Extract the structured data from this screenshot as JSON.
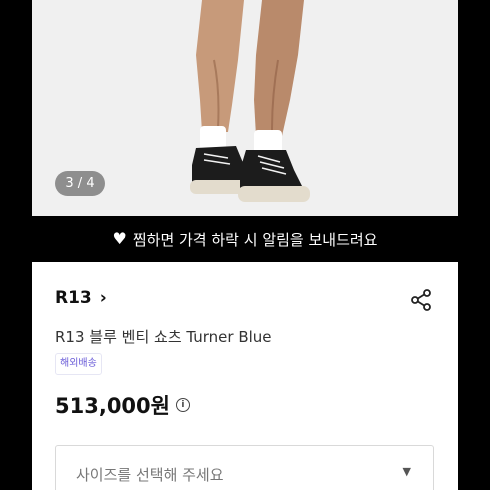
{
  "gallery": {
    "counter": "3 / 4"
  },
  "wish_bar": {
    "text": "찜하면 가격 하락 시 알림을 보내드려요",
    "icon": "heart-icon"
  },
  "product": {
    "brand": "R13",
    "title": "R13 블루 벤티 쇼츠 Turner Blue",
    "badge": "해외배송",
    "price": "513,000원",
    "size_placeholder": "사이즈를 선택해 주세요"
  },
  "colors": {
    "badge_text": "#6a5cd8",
    "background": "#000000"
  }
}
